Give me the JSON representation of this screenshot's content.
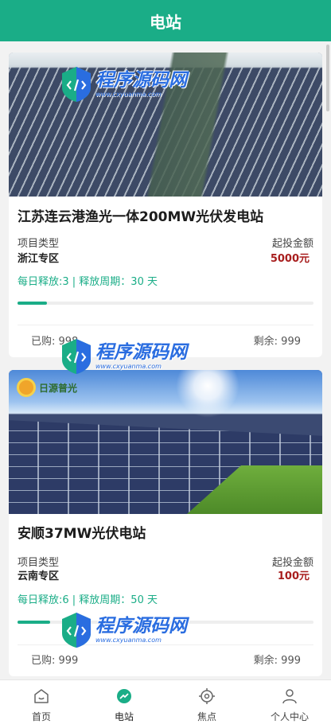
{
  "header": {
    "title": "电站"
  },
  "stations": [
    {
      "title": "江苏连云港渔光一体200MW光伏发电站",
      "type_label": "项目类型",
      "type_value": "浙江专区",
      "invest_label": "起投金额",
      "invest_value": "5000元",
      "release_text": "每日释放:3 | 释放周期：30 天",
      "progress": 0.1,
      "bought_text": "已购: 998",
      "remaining_text": "剩余: 999"
    },
    {
      "title": "安顺37MW光伏电站",
      "brand_text": "日源普光",
      "type_label": "项目类型",
      "type_value": "云南专区",
      "invest_label": "起投金额",
      "invest_value": "100元",
      "release_text": "每日释放:6 | 释放周期：50 天",
      "progress": 0.11,
      "bought_text": "已购: 999",
      "remaining_text": "剩余: 999"
    }
  ],
  "watermark": {
    "main": "程序源码网",
    "sub": "www.cxyuanma.com"
  },
  "tabbar": [
    {
      "label": "首页",
      "icon": "home-icon"
    },
    {
      "label": "电站",
      "icon": "trend-icon"
    },
    {
      "label": "焦点",
      "icon": "target-icon"
    },
    {
      "label": "个人中心",
      "icon": "user-icon"
    }
  ],
  "colors": {
    "accent": "#1aad87",
    "price": "#a81e1e",
    "watermark": "#2a6de0"
  }
}
